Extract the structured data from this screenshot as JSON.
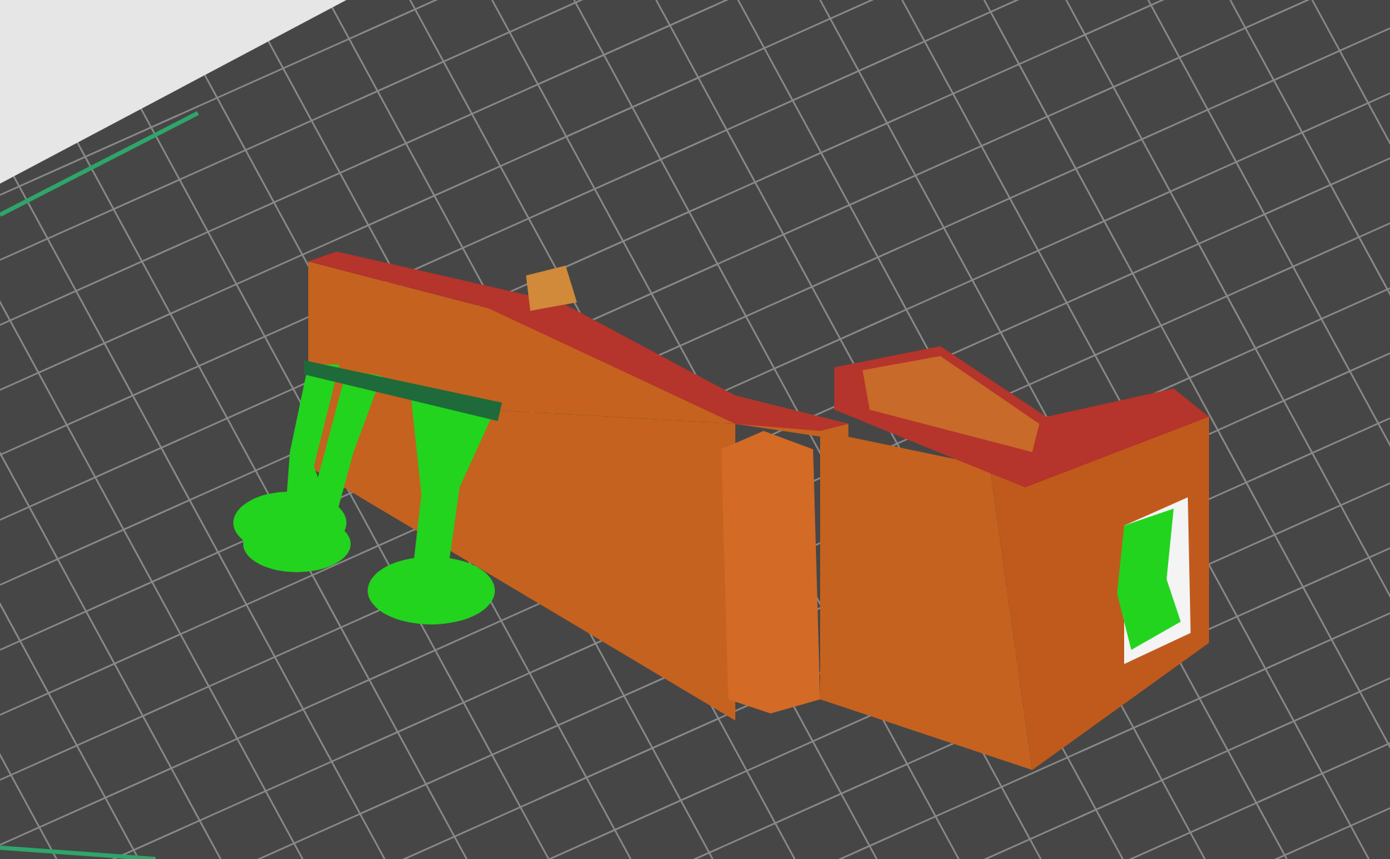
{
  "viewport": {
    "kind": "preview",
    "objects": [
      {
        "kind": "model",
        "color": "#c5621f"
      },
      {
        "kind": "support",
        "color": "#22d41e"
      }
    ]
  }
}
